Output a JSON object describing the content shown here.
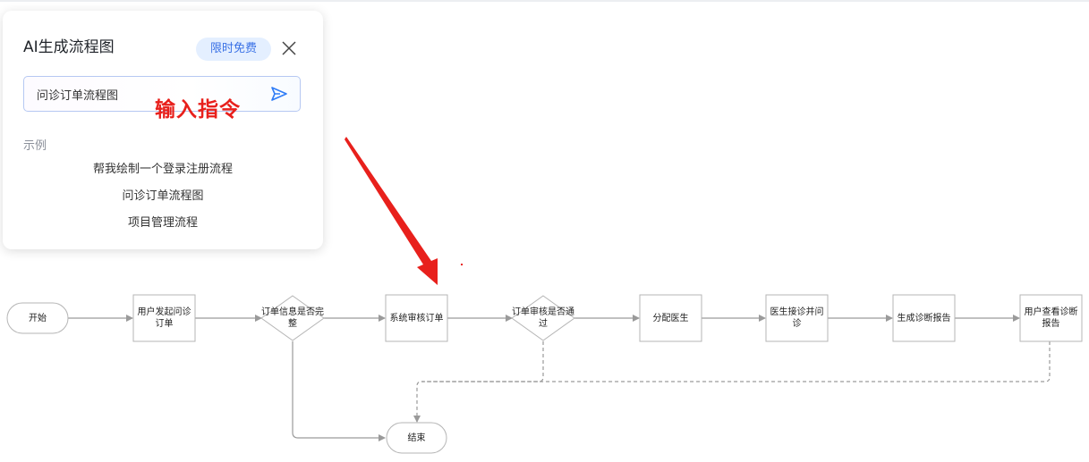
{
  "ai_panel": {
    "title": "AI生成流程图",
    "badge": "限时免费",
    "input_value": "问诊订单流程图",
    "examples_label": "示例",
    "examples": [
      "帮我绘制一个登录注册流程",
      "问诊订单流程图",
      "项目管理流程"
    ]
  },
  "annotation": {
    "text": "输入指令"
  },
  "flowchart": {
    "nodes": {
      "start": "开始",
      "user_initiate": "用户发起问诊订单",
      "info_complete": "订单信息是否完整",
      "system_review": "系统审核订单",
      "review_passed": "订单审核是否通过",
      "assign_doctor": "分配医生",
      "doctor_consult": "医生接诊并问诊",
      "generate_report": "生成诊断报告",
      "user_view": "用户查看诊断报告",
      "end": "结束"
    }
  },
  "colors": {
    "annotation_red": "#e8201c",
    "badge_bg": "#e4efff",
    "badge_text": "#3a71e6",
    "send_icon": "#2f7cf6"
  },
  "icons": [
    "close-icon",
    "send-icon"
  ]
}
